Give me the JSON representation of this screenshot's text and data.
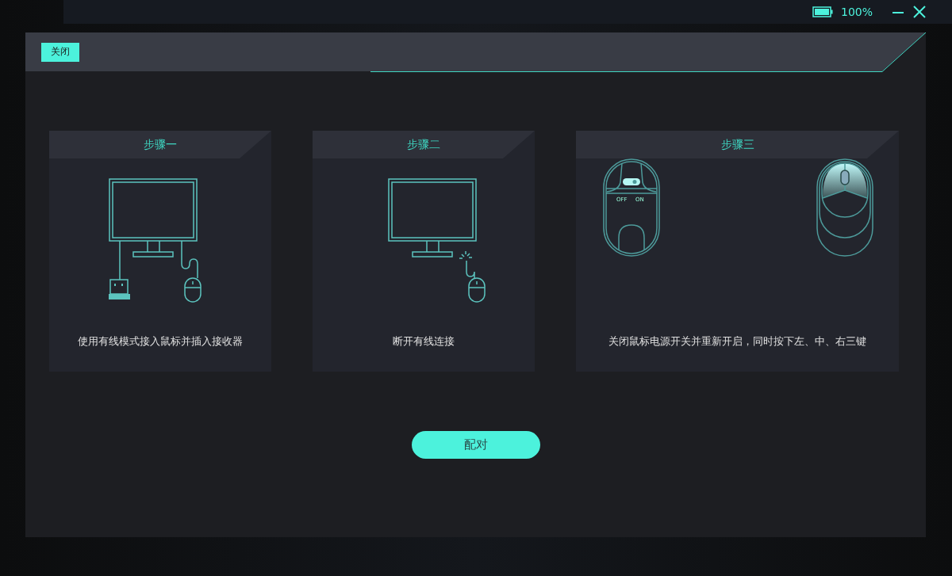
{
  "top_bar": {
    "battery": "100%"
  },
  "dialog": {
    "close_label": "关闭",
    "steps": [
      {
        "kind": "wired-setup",
        "title": "步骤一",
        "caption": "使用有线模式接入鼠标并插入接收器"
      },
      {
        "kind": "unplug",
        "title": "步骤二",
        "caption": "断开有线连接"
      },
      {
        "kind": "mouse-reset",
        "title": "步骤三",
        "caption": "关闭鼠标电源开关并重新开启，同时按下左、中、右三键",
        "switch_labels": [
          "OFF",
          "ON"
        ]
      }
    ],
    "pair_button": "配对"
  }
}
